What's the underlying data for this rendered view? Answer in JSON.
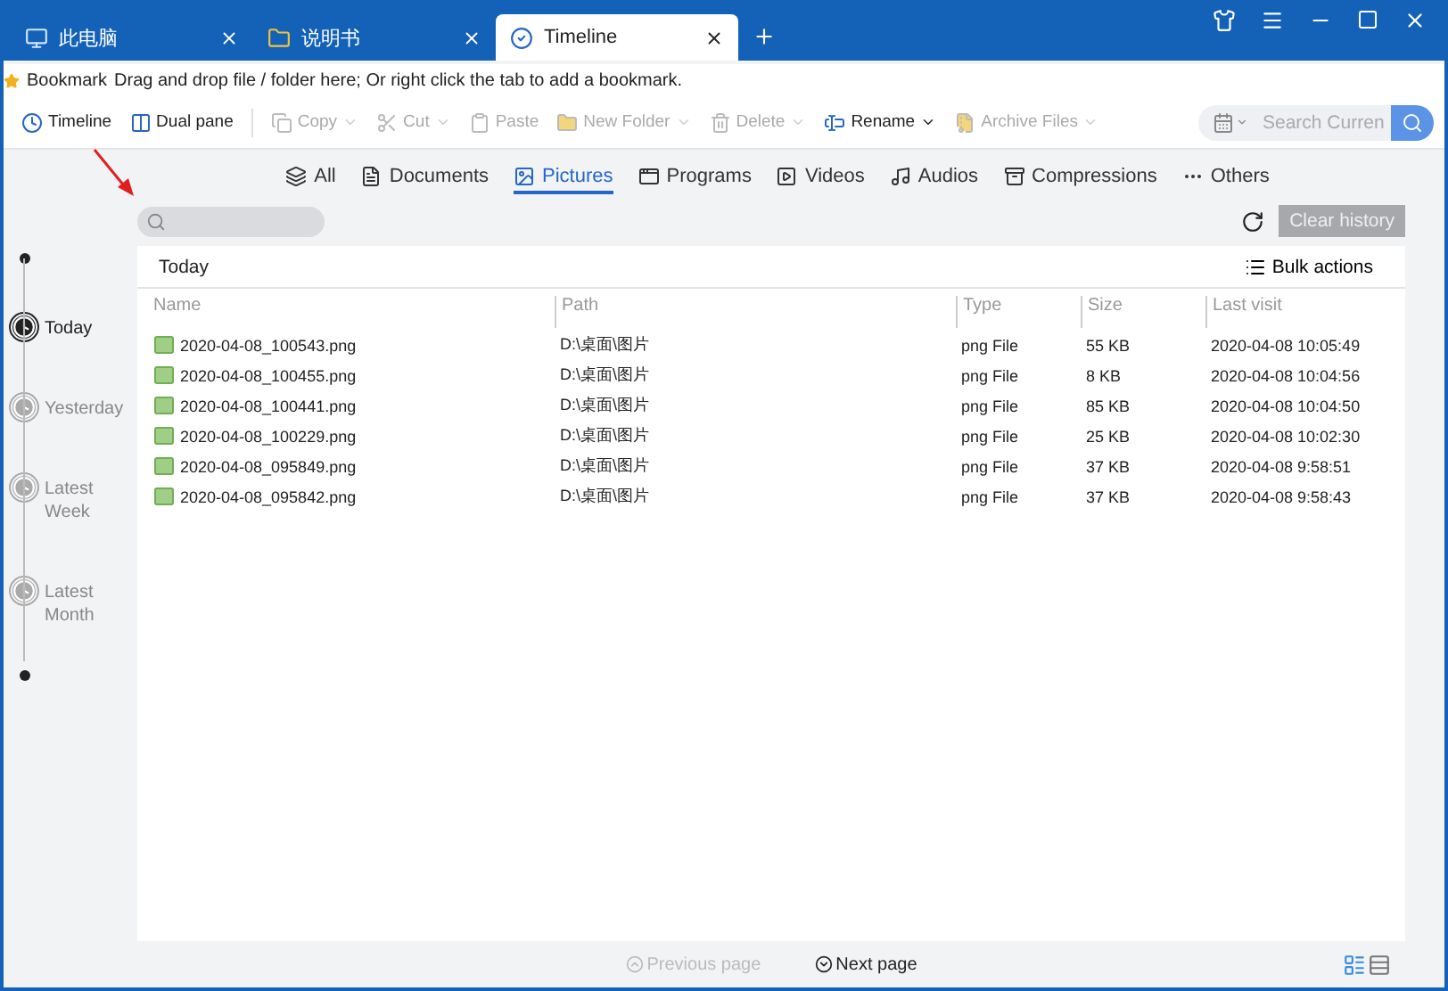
{
  "tabs": [
    {
      "label": "此电脑",
      "selected": false
    },
    {
      "label": "说明书",
      "selected": false
    },
    {
      "label": "Timeline",
      "selected": true
    }
  ],
  "bookmark_bar": {
    "label": "Bookmark",
    "hint": "Drag and drop file / folder here; Or right click the tab to add a bookmark."
  },
  "toolbar": [
    {
      "label": "Timeline",
      "disabled": false,
      "dropdown": false
    },
    {
      "label": "Dual pane",
      "disabled": false,
      "dropdown": false
    },
    {
      "label": "Copy",
      "disabled": true,
      "dropdown": true
    },
    {
      "label": "Cut",
      "disabled": true,
      "dropdown": true
    },
    {
      "label": "Paste",
      "disabled": true,
      "dropdown": false
    },
    {
      "label": "New Folder",
      "disabled": true,
      "dropdown": true
    },
    {
      "label": "Delete",
      "disabled": true,
      "dropdown": true
    },
    {
      "label": "Rename",
      "disabled": false,
      "dropdown": true
    },
    {
      "label": "Archive Files",
      "disabled": true,
      "dropdown": true
    }
  ],
  "search": {
    "placeholder": "Search Curren"
  },
  "categories": [
    {
      "label": "All",
      "selected": false
    },
    {
      "label": "Documents",
      "selected": false
    },
    {
      "label": "Pictures",
      "selected": true
    },
    {
      "label": "Programs",
      "selected": false
    },
    {
      "label": "Videos",
      "selected": false
    },
    {
      "label": "Audios",
      "selected": false
    },
    {
      "label": "Compressions",
      "selected": false
    },
    {
      "label": "Others",
      "selected": false
    }
  ],
  "clear_history": "Clear history",
  "timeline": [
    {
      "label": "Today",
      "selected": true
    },
    {
      "label": "Yesterday",
      "selected": false
    },
    {
      "label": "Latest Week",
      "selected": false
    },
    {
      "label": "Latest Month",
      "selected": false
    }
  ],
  "panel": {
    "title": "Today",
    "bulk_actions": "Bulk actions",
    "columns": [
      "Name",
      "Path",
      "Type",
      "Size",
      "Last visit"
    ],
    "rows": [
      [
        "2020-04-08_100543.png",
        "D:\\桌面\\图片",
        "png File",
        "55 KB",
        "2020-04-08 10:05:49"
      ],
      [
        "2020-04-08_100455.png",
        "D:\\桌面\\图片",
        "png File",
        "8 KB",
        "2020-04-08 10:04:56"
      ],
      [
        "2020-04-08_100441.png",
        "D:\\桌面\\图片",
        "png File",
        "85 KB",
        "2020-04-08 10:04:50"
      ],
      [
        "2020-04-08_100229.png",
        "D:\\桌面\\图片",
        "png File",
        "25 KB",
        "2020-04-08 10:02:30"
      ],
      [
        "2020-04-08_095849.png",
        "D:\\桌面\\图片",
        "png File",
        "37 KB",
        "2020-04-08 9:58:51"
      ],
      [
        "2020-04-08_095842.png",
        "D:\\桌面\\图片",
        "png File",
        "37 KB",
        "2020-04-08 9:58:43"
      ]
    ]
  },
  "pagination": {
    "previous": {
      "label": "Previous page",
      "disabled": true
    },
    "next": {
      "label": "Next page",
      "disabled": false
    }
  }
}
